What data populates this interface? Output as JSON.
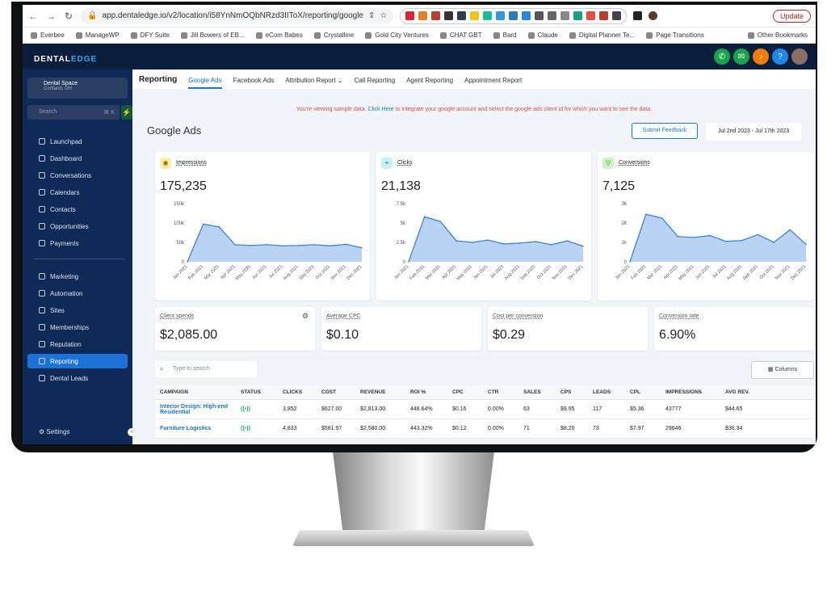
{
  "browser": {
    "url": "app.dentaledge.io/v2/location/i58YnNmOQbNRzd3IIToX/reporting/google",
    "update_label": "Update",
    "bookmarks": [
      "Everbee",
      "ManageWP",
      "DFY Suite",
      "Jill Bowers of EB...",
      "eCom Babes",
      "Crystalline",
      "Gold City Ventures",
      "CHAT GBT",
      "Bard",
      "Claude",
      "Digital Planner Te...",
      "Page Transitions"
    ],
    "other_bookmarks": "Other Bookmarks"
  },
  "brand": {
    "logo_part1": "DENTAL",
    "logo_part2": "EDGE",
    "accent": "#1976d2",
    "nav_bg": "#0e2a56"
  },
  "sidebar": {
    "location_name": "Dental Space",
    "location_city": "Cortland, OH",
    "search_placeholder": "Search",
    "search_shortcut": "⌘ K",
    "items": [
      {
        "label": "Launchpad",
        "icon": "rocket-icon"
      },
      {
        "label": "Dashboard",
        "icon": "grid-icon"
      },
      {
        "label": "Conversations",
        "icon": "chat-icon"
      },
      {
        "label": "Calendars",
        "icon": "calendar-icon"
      },
      {
        "label": "Contacts",
        "icon": "contacts-icon"
      },
      {
        "label": "Opportunities",
        "icon": "opportunities-icon"
      },
      {
        "label": "Payments",
        "icon": "payments-icon"
      },
      {
        "label": "Marketing",
        "icon": "send-icon"
      },
      {
        "label": "Automation",
        "icon": "automation-icon"
      },
      {
        "label": "Sites",
        "icon": "sites-icon"
      },
      {
        "label": "Memberships",
        "icon": "membership-icon"
      },
      {
        "label": "Reputation",
        "icon": "star-icon"
      },
      {
        "label": "Reporting",
        "icon": "chart-icon"
      },
      {
        "label": "Dental Leads",
        "icon": "people-icon"
      }
    ],
    "settings_label": "Settings"
  },
  "tabs": {
    "title": "Reporting",
    "items": [
      "Google Ads",
      "Facebook Ads",
      "Attribution Report",
      "Call Reporting",
      "Agent Reporting",
      "Appointment Report"
    ]
  },
  "notice": {
    "before": "You're viewing sample data.",
    "link": "Click Here",
    "after": "to integrate your google account and select the google ads client id for which you want to see the data."
  },
  "page": {
    "title": "Google Ads",
    "feedback_label": "Submit Feedback",
    "date_range": "Jul 2nd 2023 - Jul 17th 2023"
  },
  "chart_data": [
    {
      "type": "area",
      "title": "Impressions",
      "total": "175,235",
      "categories": [
        "Jan 2021",
        "Feb 2021",
        "Mar 2021",
        "Apr 2021",
        "May 2021",
        "Jun 2021",
        "Jul 2021",
        "Aug 2021",
        "Sep 2021",
        "Oct 2021",
        "Nov 2021",
        "Dec 2021"
      ],
      "values": [
        0,
        97000,
        90000,
        44000,
        42000,
        44000,
        41000,
        42000,
        44000,
        41000,
        45000,
        36000
      ],
      "yticks": [
        "0",
        "50k",
        "100k",
        "150k"
      ],
      "ylim": [
        0,
        150000
      ]
    },
    {
      "type": "area",
      "title": "Clicks",
      "total": "21,138",
      "categories": [
        "Jan 2021",
        "Feb 2021",
        "Mar 2021",
        "Apr 2021",
        "May 2021",
        "Jun 2021",
        "Jul 2021",
        "Aug 2021",
        "Sep 2021",
        "Oct 2021",
        "Nov 2021",
        "Dec 2021"
      ],
      "values": [
        0,
        5800,
        5200,
        2700,
        2500,
        2800,
        2300,
        2400,
        2600,
        2200,
        2700,
        2000
      ],
      "yticks": [
        "0",
        "2.5k",
        "5k",
        "7.5k"
      ],
      "ylim": [
        0,
        7500
      ]
    },
    {
      "type": "area",
      "title": "Conversions",
      "total": "7,125",
      "categories": [
        "Jan 2021",
        "Feb 2021",
        "Mar 2021",
        "Apr 2021",
        "May 2021",
        "Jun 2021",
        "Jul 2021",
        "Aug 2021",
        "Sep 2021",
        "Oct 2021",
        "Nov 2021",
        "Dec 2021"
      ],
      "values": [
        0,
        2450,
        2250,
        1300,
        1250,
        1350,
        1050,
        1100,
        1400,
        1000,
        1650,
        900
      ],
      "yticks": [
        "0",
        "1k",
        "2k",
        "3k"
      ],
      "ylim": [
        0,
        3000
      ]
    }
  ],
  "stats": [
    {
      "label": "Client spends",
      "value": "$2,085.00"
    },
    {
      "label": "Average CPC",
      "value": "$0.10"
    },
    {
      "label": "Cost per conversion",
      "value": "$0.29"
    },
    {
      "label": "Conversion rate",
      "value": "6.90%"
    }
  ],
  "table": {
    "search_placeholder": "Type to search",
    "columns_label": "Columns",
    "headers": [
      "CAMPAIGN",
      "STATUS",
      "CLICKS",
      "COST",
      "REVENUE",
      "ROI %",
      "CPC",
      "CTR",
      "SALES",
      "CPS",
      "LEADS",
      "CPL",
      "IMPRESSIONS",
      "AVG REV."
    ],
    "rows": [
      [
        "Interior Design: High-end Residential",
        "((•))",
        "3,852",
        "$627.00",
        "$2,813.00",
        "448.64%",
        "$0.16",
        "0.00%",
        "63",
        "$9.95",
        "117",
        "$5.36",
        "43777",
        "$44.65"
      ],
      [
        "Furniture Logistics",
        "((•))",
        "4,833",
        "$581.97",
        "$2,580.00",
        "443.32%",
        "$0.12",
        "0.00%",
        "71",
        "$8.20",
        "73",
        "$7.97",
        "29646",
        "$36.34"
      ]
    ]
  }
}
